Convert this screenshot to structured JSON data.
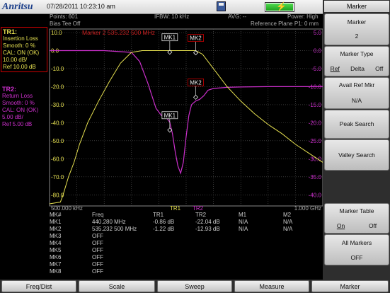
{
  "header": {
    "brand": "Anritsu",
    "datetime": "07/28/2011 10:23:10 am"
  },
  "status": {
    "points": "Points: 601",
    "ifbw": "IFBW: 10 kHz",
    "avg": "AVG: --",
    "power": "Power: High",
    "bias_tee": "Bias Tee Off",
    "ref_plane": "Reference Plane P1: 0 mm",
    "active_marker": "Marker 2 535.232 500 MHz"
  },
  "traces": {
    "tr1": {
      "title": "TR1:",
      "lines": [
        "Insertion Loss",
        "Smooth: 0 %",
        "CAL: ON (OK)",
        "10.00 dB/",
        "Ref 10.00 dB"
      ]
    },
    "tr2": {
      "title": "TR2:",
      "lines": [
        "Return Loss",
        "Smooth: 0 %",
        "CAL: ON (OK)",
        "5.00 dB/",
        "Ref 5.00 dB"
      ]
    }
  },
  "colors": {
    "tr1": "#e6e050",
    "tr2": "#cc2fcc",
    "grid": "#5a5a5a",
    "active_box": "#cc0000"
  },
  "chart_data": {
    "type": "line",
    "xlabel": "",
    "x_start": "500.000 kHz",
    "x_stop": "1.000 GHz",
    "trace_tags": [
      "TR1",
      "TR2"
    ],
    "left_axis": {
      "ticks": [
        "10.0",
        "0.0",
        "-10.0",
        "-20.0",
        "-30.0",
        "-40.0",
        "-50.0",
        "-60.0",
        "-70.0",
        "-80.0"
      ],
      "ylim": [
        -85,
        10
      ]
    },
    "right_axis": {
      "ticks": [
        "5.0",
        "0.0",
        "-5.0",
        "-10.0",
        "-15.0",
        "-20.0",
        "-25.0",
        "-30.0",
        "-35.0",
        "-40.0"
      ],
      "ylim": [
        -42.5,
        5
      ]
    },
    "series": [
      {
        "name": "TR1",
        "axis": "left",
        "x_mhz": [
          0.5,
          40,
          50,
          70,
          90,
          110,
          140,
          180,
          220,
          260,
          300,
          340,
          360,
          380,
          400,
          420,
          440,
          460,
          490,
          520,
          535,
          560,
          590,
          620,
          650,
          700,
          750,
          800,
          850,
          900,
          950,
          1000
        ],
        "values": [
          -85,
          -84,
          -80,
          -70,
          -62,
          -52,
          -40,
          -28,
          -17,
          -7,
          -1,
          0,
          0,
          0,
          0,
          0,
          0,
          0,
          0,
          0,
          0,
          -2,
          -8,
          -14,
          -20,
          -28,
          -35,
          -41,
          -46,
          -52,
          -57,
          -62
        ]
      },
      {
        "name": "TR2",
        "axis": "right",
        "x_mhz": [
          0.5,
          200,
          300,
          330,
          360,
          390,
          410,
          420,
          430,
          440,
          450,
          460,
          470,
          480,
          490,
          500,
          510,
          520,
          535,
          550,
          565,
          580,
          600,
          650,
          700,
          800,
          900,
          1000
        ],
        "values": [
          0,
          0,
          -0.5,
          -3,
          -9,
          -16,
          -18,
          -18.3,
          -18.8,
          -19.8,
          -23,
          -28,
          -32,
          -34,
          -31,
          -24,
          -18,
          -15,
          -14,
          -13.5,
          -12.5,
          -11,
          -10.5,
          -10.2,
          -10.1,
          -10,
          -10,
          -10
        ]
      }
    ],
    "markers": [
      {
        "label": "MK1",
        "trace": "TR1",
        "x_mhz": 440.28,
        "value": -0.86
      },
      {
        "label": "MK2",
        "trace": "TR1",
        "x_mhz": 535.2325,
        "value": -1.22
      },
      {
        "label": "MK1",
        "trace": "TR2",
        "x_mhz": 440.28,
        "value": -22.04
      },
      {
        "label": "MK2",
        "trace": "TR2",
        "x_mhz": 535.2325,
        "value": -12.93
      }
    ]
  },
  "marker_table": {
    "headers": [
      "MK#",
      "Freq",
      "TR1",
      "TR2",
      "M1",
      "M2"
    ],
    "rows": [
      [
        "MK1",
        "440.280 MHz",
        "-0.86 dB",
        "-22.04 dB",
        "N/A",
        "N/A"
      ],
      [
        "MK2",
        "535.232 500 MHz",
        "-1.22 dB",
        "-12.93 dB",
        "N/A",
        "N/A"
      ],
      [
        "MK3",
        "OFF",
        "",
        "",
        "",
        ""
      ],
      [
        "MK4",
        "OFF",
        "",
        "",
        "",
        ""
      ],
      [
        "MK5",
        "OFF",
        "",
        "",
        "",
        ""
      ],
      [
        "MK6",
        "OFF",
        "",
        "",
        "",
        ""
      ],
      [
        "MK7",
        "OFF",
        "",
        "",
        "",
        ""
      ],
      [
        "MK8",
        "OFF",
        "",
        "",
        "",
        ""
      ]
    ]
  },
  "softkeys": {
    "title": "Marker",
    "marker": {
      "label": "Marker",
      "value": "2"
    },
    "marker_type": {
      "label": "Marker Type",
      "opt1": "Ref",
      "opt2": "Delta",
      "opt3": "Off"
    },
    "avail_ref": {
      "label": "Avail Ref Mkr",
      "value": "N/A"
    },
    "peak_search": "Peak Search",
    "valley_search": "Valley Search",
    "marker_table": {
      "label": "Marker Table",
      "opt1": "On",
      "opt2": "Off"
    },
    "all_markers": {
      "label": "All Markers",
      "value": "OFF"
    }
  },
  "bottom": [
    "Freq/Dist",
    "Scale",
    "Sweep",
    "Measure",
    "Marker"
  ]
}
